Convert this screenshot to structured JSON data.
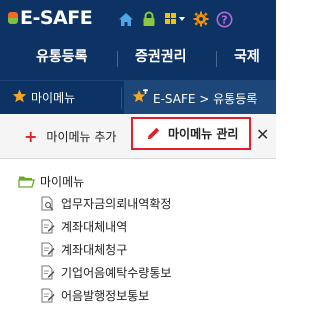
{
  "header": {
    "logo_text": "E-SAFE",
    "icons": [
      "home-icon",
      "lock-icon",
      "grid-icon",
      "gear-icon",
      "help-icon"
    ]
  },
  "main_menu": [
    {
      "label": "유통등록"
    },
    {
      "label": "증권권리"
    },
    {
      "label": "국제"
    }
  ],
  "bookmark_bar": {
    "my_menu_label": "마이메뉴",
    "breadcrumb": "E-SAFE > 유통등록"
  },
  "toolbar": {
    "add_label": "마이메뉴 추가",
    "manage_label": "마이메뉴 관리",
    "close_symbol": "✕"
  },
  "tree": {
    "root_label": "마이메뉴",
    "items": [
      {
        "label": "업무자금의뢰내역확정",
        "icon": "search-doc-icon"
      },
      {
        "label": "계좌대체내역",
        "icon": "edit-doc-icon"
      },
      {
        "label": "계좌대체청구",
        "icon": "edit-doc-icon"
      },
      {
        "label": "기업어음예탁수량통보",
        "icon": "edit-doc-icon"
      },
      {
        "label": "어음발행정보통보",
        "icon": "edit-doc-icon"
      }
    ]
  },
  "colors": {
    "header_bg": "#0c3364",
    "highlight_border": "#e2202c",
    "accent_red": "#d9232d",
    "star_yellow": "#f5a623"
  }
}
